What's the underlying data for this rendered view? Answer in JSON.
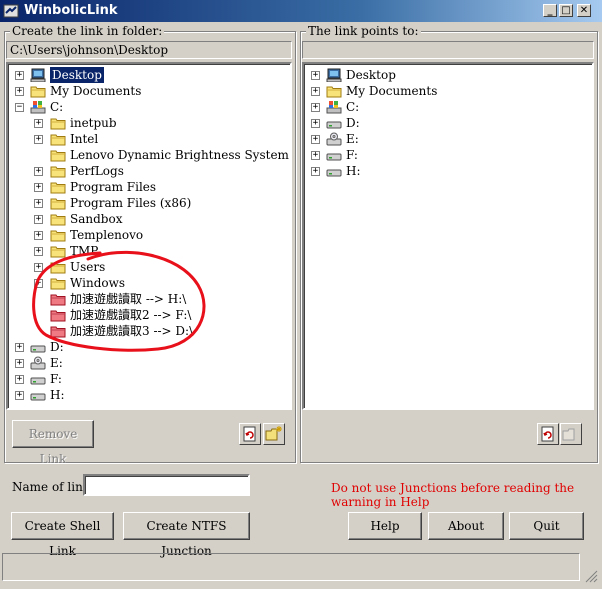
{
  "window": {
    "title": "WinbolicLink",
    "min": "_",
    "max": "□",
    "close": "✕"
  },
  "left_panel": {
    "label": "Create the link in folder:",
    "path": "C:\\Users\\johnson\\Desktop",
    "nodes": [
      {
        "label": "Desktop",
        "icon": "desktop-icon",
        "selected": true
      },
      {
        "label": "My Documents",
        "icon": "folder-icon"
      },
      {
        "label": "C:",
        "icon": "drive-c-icon"
      },
      {
        "label": "inetpub",
        "icon": "folder-icon"
      },
      {
        "label": "Intel",
        "icon": "folder-icon"
      },
      {
        "label": "Lenovo Dynamic Brightness System",
        "icon": "folder-icon"
      },
      {
        "label": "PerfLogs",
        "icon": "folder-icon"
      },
      {
        "label": "Program Files",
        "icon": "folder-icon"
      },
      {
        "label": "Program Files (x86)",
        "icon": "folder-icon"
      },
      {
        "label": "Sandbox",
        "icon": "folder-icon"
      },
      {
        "label": "Templenovo",
        "icon": "folder-icon"
      },
      {
        "label": "TMP",
        "icon": "folder-icon"
      },
      {
        "label": "Users",
        "icon": "folder-icon"
      },
      {
        "label": "Windows",
        "icon": "folder-icon"
      },
      {
        "label": "加速遊戲讀取 --> H:\\",
        "icon": "link-folder-icon"
      },
      {
        "label": "加速遊戲讀取2 --> F:\\",
        "icon": "link-folder-icon"
      },
      {
        "label": "加速遊戲讀取3 --> D:\\",
        "icon": "link-folder-icon"
      },
      {
        "label": "D:",
        "icon": "drive-icon"
      },
      {
        "label": "E:",
        "icon": "cd-drive-icon"
      },
      {
        "label": "F:",
        "icon": "drive-icon"
      },
      {
        "label": "H:",
        "icon": "drive-icon"
      }
    ],
    "remove_link_label": "Remove Link"
  },
  "right_panel": {
    "label": "The link points to:",
    "path": "",
    "nodes": [
      {
        "label": "Desktop",
        "icon": "desktop-icon"
      },
      {
        "label": "My Documents",
        "icon": "folder-icon"
      },
      {
        "label": "C:",
        "icon": "drive-c-icon"
      },
      {
        "label": "D:",
        "icon": "drive-icon"
      },
      {
        "label": "E:",
        "icon": "cd-drive-icon"
      },
      {
        "label": "F:",
        "icon": "drive-icon"
      },
      {
        "label": "H:",
        "icon": "drive-icon"
      }
    ]
  },
  "name_of_link": {
    "label": "Name of link:",
    "value": ""
  },
  "warning": "Do not use Junctions before reading the warning in Help",
  "buttons": {
    "create_shell_link": "Create Shell Link",
    "create_ntfs_junction": "Create NTFS Junction",
    "help": "Help",
    "about": "About",
    "quit": "Quit"
  },
  "colors": {
    "warning_red": "#e00000",
    "selection": "#0a246a",
    "annotation_red": "#e8101a"
  }
}
